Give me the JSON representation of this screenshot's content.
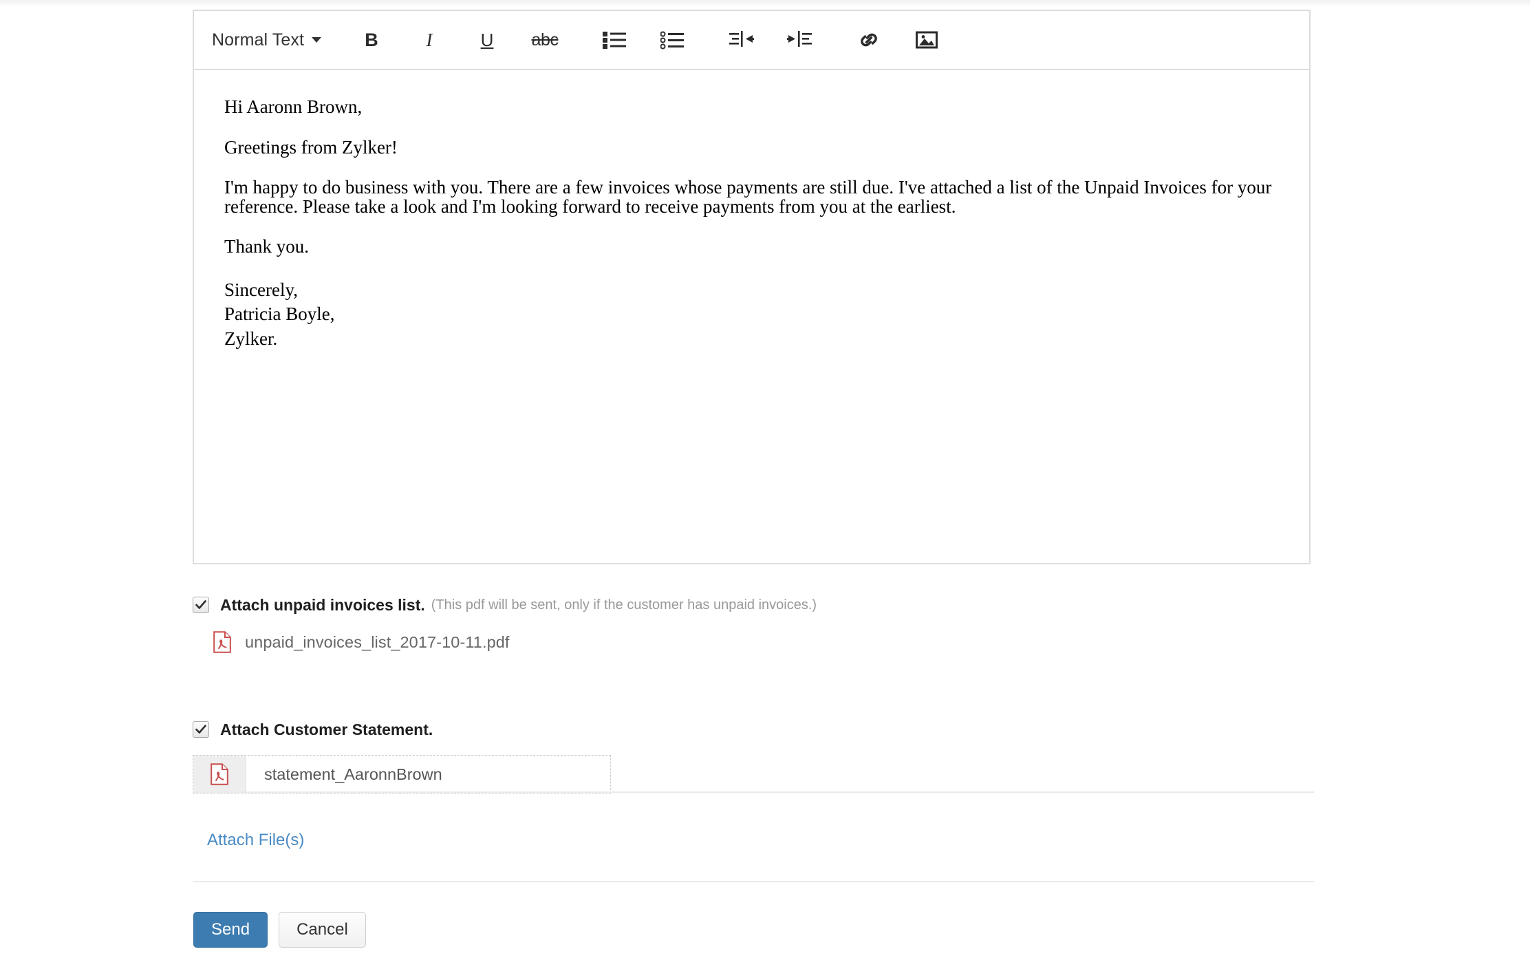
{
  "editor": {
    "toolbar": {
      "style_label": "Normal Text",
      "bold_label": "B",
      "italic_label": "I",
      "underline_label": "U",
      "strikethrough_label": "abc",
      "bullet_list_label": "unordered-list",
      "numbered_list_label": "ordered-list",
      "outdent_label": "outdent",
      "indent_label": "indent",
      "link_label": "link",
      "image_label": "image"
    },
    "body": {
      "greeting": "Hi Aaronn Brown,",
      "line2": "Greetings from Zylker!",
      "paragraph": "I'm happy to do business with you. There are a few invoices whose payments are still due. I've attached a list of the Unpaid Invoices for your reference. Please take a look and I'm looking forward to receive payments from you at the earliest.",
      "thanks": "Thank you.",
      "sign_off": "Sincerely,",
      "sender_name": "Patricia Boyle,",
      "sender_company": "Zylker."
    }
  },
  "attachments": {
    "unpaid": {
      "label": "Attach unpaid invoices list.",
      "hint": "(This pdf will be sent, only if the customer has unpaid invoices.)",
      "checked": true,
      "file_name": "unpaid_invoices_list_2017-10-11.pdf"
    },
    "statement": {
      "label": "Attach Customer Statement.",
      "checked": true,
      "file_name": "statement_AaronnBrown"
    },
    "attach_files_link": "Attach File(s)"
  },
  "actions": {
    "send_label": "Send",
    "cancel_label": "Cancel"
  },
  "colors": {
    "accent_blue": "#3d7cb0",
    "link_blue": "#4a8ac4",
    "pdf_red": "#c94f4f",
    "border_gray": "#dddddd"
  }
}
